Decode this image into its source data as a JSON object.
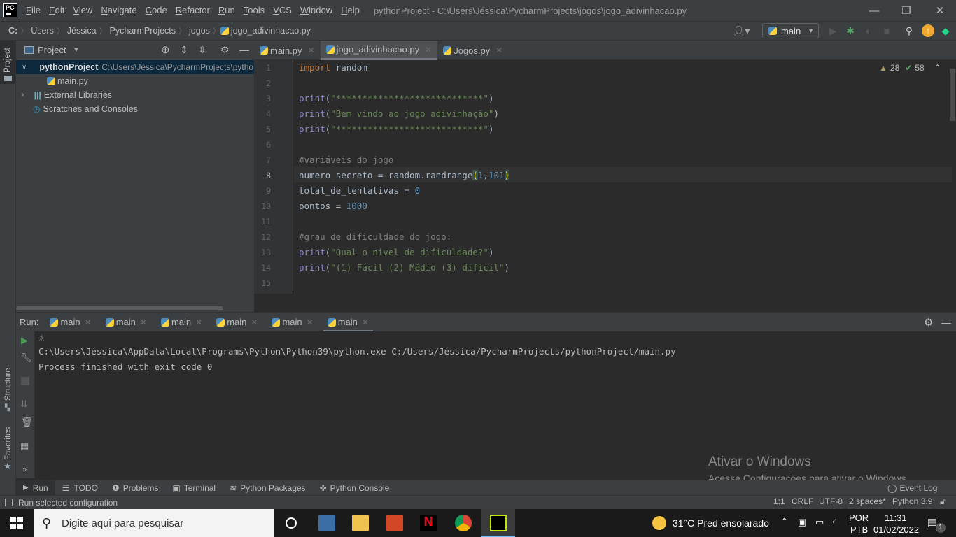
{
  "titlebar": {
    "logo": "PC",
    "menu": [
      "File",
      "Edit",
      "View",
      "Navigate",
      "Code",
      "Refactor",
      "Run",
      "Tools",
      "VCS",
      "Window",
      "Help"
    ],
    "window_title": "pythonProject - C:\\Users\\Jéssica\\PycharmProjects\\jogos\\jogo_adivinhacao.py",
    "minimize": "—",
    "restore": "❐",
    "close": "✕"
  },
  "navbar": {
    "breadcrumbs": [
      "C:",
      "Users",
      "Jéssica",
      "PycharmProjects",
      "jogos",
      "jogo_adivinhacao.py"
    ],
    "separator": "〉",
    "run_config": "main",
    "run_config_caret": "▼"
  },
  "project_panel": {
    "title": "Project",
    "tree": [
      {
        "label": "pythonProject",
        "path": "C:\\Users\\Jéssica\\PycharmProjects\\pythonProject"
      },
      {
        "label": "main.py"
      },
      {
        "label": "External Libraries"
      },
      {
        "label": "Scratches and Consoles"
      }
    ]
  },
  "left_stripe": {
    "project": "Project",
    "structure": "Structure",
    "favorites": "Favorites"
  },
  "editor": {
    "tabs": [
      {
        "label": "main.py",
        "active": false
      },
      {
        "label": "jogo_adivinhacao.py",
        "active": true
      },
      {
        "label": "Jogos.py",
        "active": false
      }
    ],
    "warnings": "28",
    "typos": "58",
    "current_line": 8,
    "lines": [
      {
        "n": "1"
      },
      {
        "n": "2"
      },
      {
        "n": "3"
      },
      {
        "n": "4"
      },
      {
        "n": "5"
      },
      {
        "n": "6"
      },
      {
        "n": "7"
      },
      {
        "n": "8"
      },
      {
        "n": "9"
      },
      {
        "n": "10"
      },
      {
        "n": "11"
      },
      {
        "n": "12"
      },
      {
        "n": "13"
      },
      {
        "n": "14"
      },
      {
        "n": "15"
      }
    ],
    "code": {
      "l1_kw": "import",
      "l1_rest": " random",
      "print": "print",
      "l3_str": "\"****************************\"",
      "l4_str": "\"Bem vindo ao jogo adivinhação\"",
      "l5_str": "\"****************************\"",
      "l7": "#variáveis do jogo",
      "l8_a": "numero_secreto = random.randrange",
      "l8_n1": "1",
      "l8_n2": "101",
      "l9_a": "total_de_tentativas = ",
      "l9_n": "0",
      "l10_a": "pontos = ",
      "l10_n": "1000",
      "l12": "#grau de dificuldade do jogo:",
      "l13_str": "\"Qual o nivel de dificuldade?\"",
      "l14_str": "\"(1) Fácil (2) Médio (3) dificil\""
    }
  },
  "run_panel": {
    "label": "Run:",
    "tabs": [
      "main",
      "main",
      "main",
      "main",
      "main",
      "main"
    ],
    "active_tab": 5,
    "console": [
      "C:\\Users\\Jéssica\\AppData\\Local\\Programs\\Python\\Python39\\python.exe C:/Users/Jéssica/PycharmProjects/pythonProject/main.py",
      "Process finished with exit code 0"
    ]
  },
  "tool_tabs": [
    "Run",
    "TODO",
    "Problems",
    "Terminal",
    "Python Packages",
    "Python Console"
  ],
  "event_log": "Event Log",
  "statusbar": {
    "message": "Run selected configuration",
    "position": "1:1",
    "line_sep": "CRLF",
    "encoding": "UTF-8",
    "indent": "2 spaces*",
    "interpreter": "Python 3.9"
  },
  "watermark": {
    "title": "Ativar o Windows",
    "subtitle": "Acesse Configurações para ativar o Windows."
  },
  "taskbar": {
    "search_placeholder": "Digite aqui para pesquisar",
    "weather": "31°C  Pred ensolarado",
    "lang1": "POR",
    "lang2": "PTB",
    "time": "11:31",
    "date": "01/02/2022",
    "notifications": "1"
  }
}
